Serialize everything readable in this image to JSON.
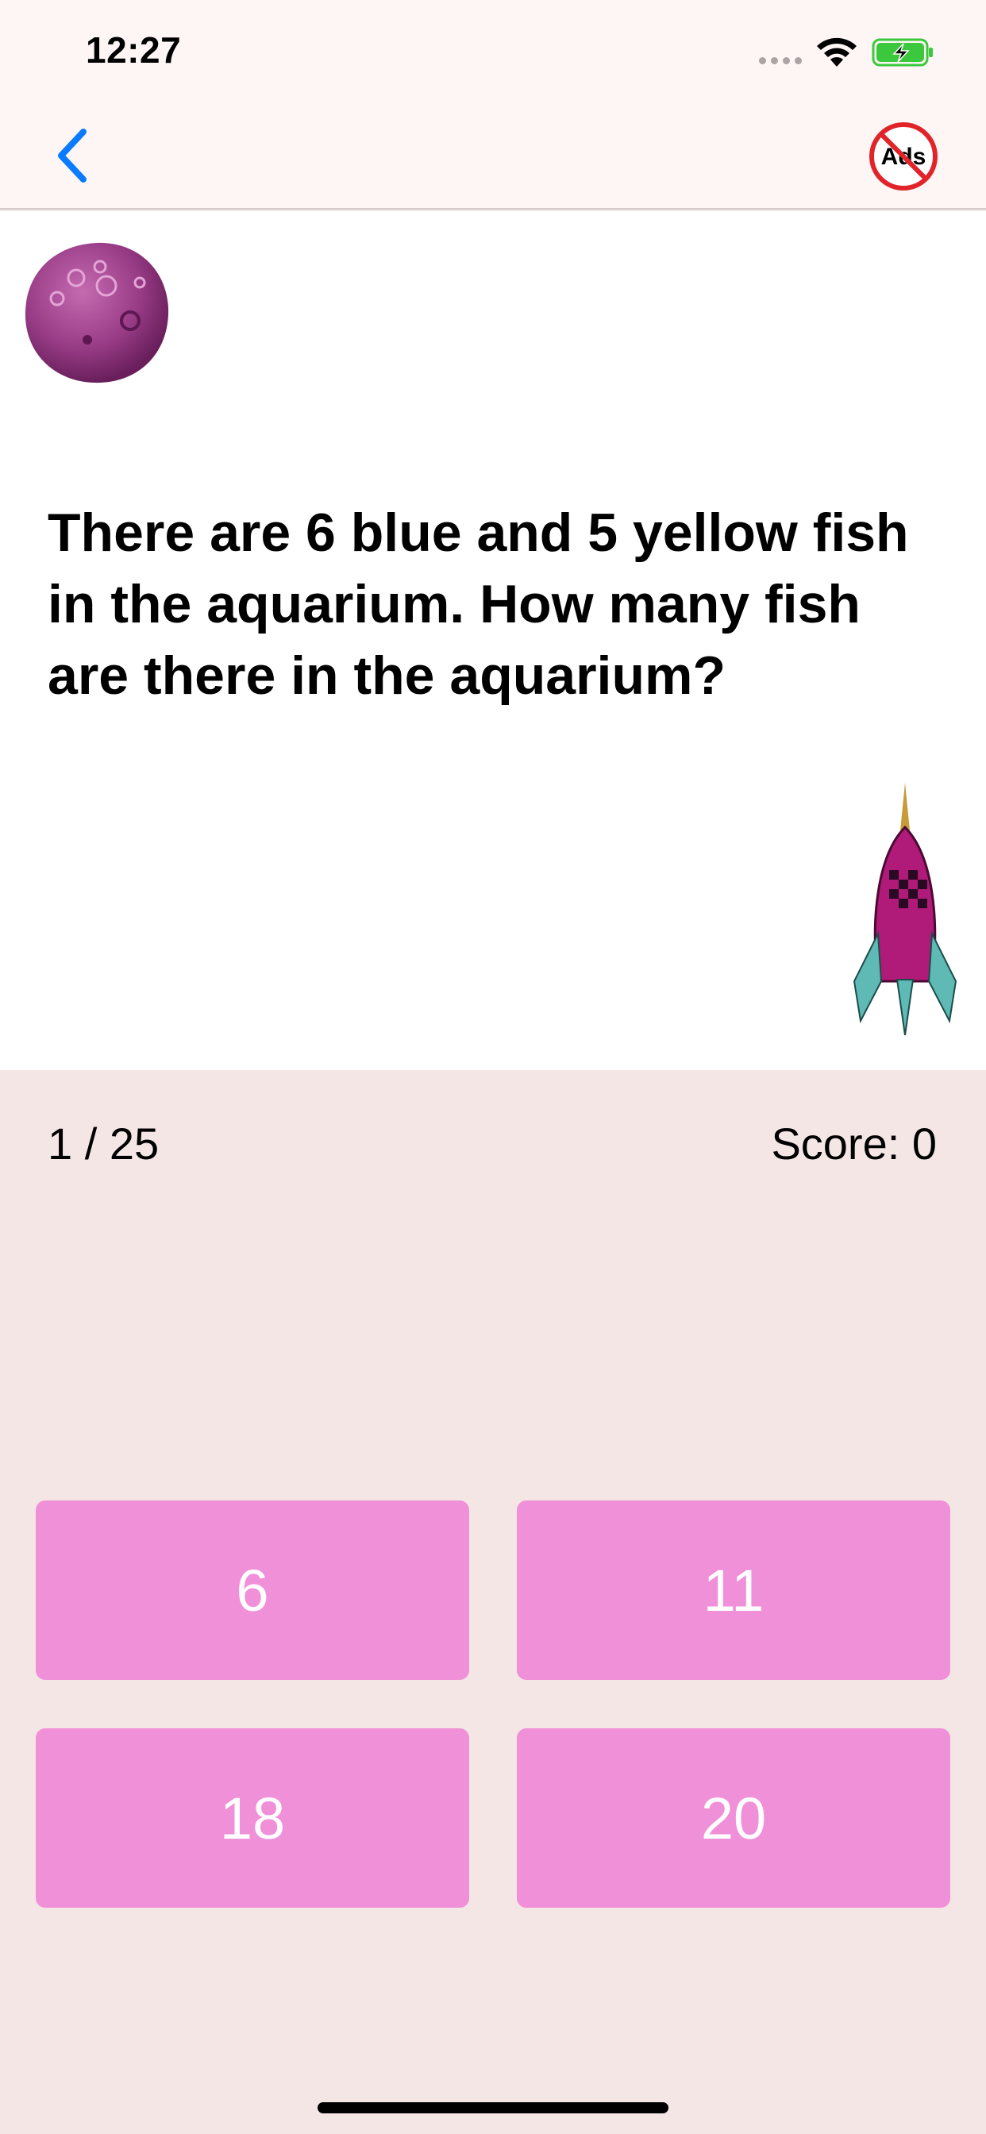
{
  "status_bar": {
    "time": "12:27",
    "icons": [
      "signal-dots-icon",
      "wifi-icon",
      "battery-charging-icon"
    ],
    "battery_color": "#3cc83c"
  },
  "nav": {
    "back_icon": "chevron-left-icon",
    "back_color": "#0a7aff",
    "ads_badge_text": "Ads",
    "ads_badge_color": "#e0242a"
  },
  "question": {
    "text": "There are 6 blue and 5 yellow fish in the aquarium. How many fish are there in the aquarium?",
    "decorations": [
      "planet-icon",
      "rocket-icon"
    ]
  },
  "quiz_status": {
    "progress": "1 / 25",
    "score": "Score: 0"
  },
  "answers": [
    {
      "label": "6"
    },
    {
      "label": "11"
    },
    {
      "label": "18"
    },
    {
      "label": "20"
    }
  ],
  "colors": {
    "answer_button": "#f090d8",
    "bottom_background": "#f5e6e6",
    "top_background": "#fdf6f5"
  }
}
